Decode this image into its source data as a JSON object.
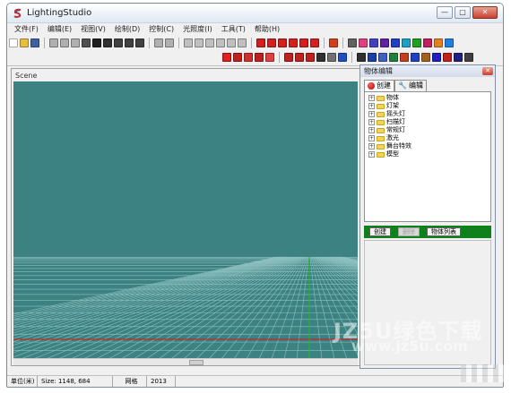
{
  "window": {
    "title": "LightingStudio",
    "minimize": "—",
    "maximize": "□",
    "close": "✕"
  },
  "menu": [
    "文件(F)",
    "编辑(E)",
    "视图(V)",
    "绘制(D)",
    "控制(C)",
    "光照度(I)",
    "工具(T)",
    "帮助(H)"
  ],
  "toolbar1": [
    {
      "icon": "new-icon",
      "color": "#ffffff"
    },
    {
      "icon": "open-icon",
      "color": "#e8c040"
    },
    {
      "icon": "save-icon",
      "color": "#4060a0"
    },
    {
      "sep": true
    },
    {
      "icon": "rotate-x-icon",
      "color": "#b0b0b0"
    },
    {
      "icon": "rotate-y-icon",
      "color": "#b0b0b0"
    },
    {
      "icon": "rotate-z-icon",
      "color": "#b0b0b0"
    },
    {
      "icon": "move-icon",
      "color": "#505050"
    },
    {
      "icon": "pointer-icon",
      "color": "#202020"
    },
    {
      "icon": "pan-icon",
      "color": "#303030"
    },
    {
      "icon": "camera-icon",
      "color": "#404040"
    },
    {
      "icon": "zoom-icon",
      "color": "#404040"
    },
    {
      "icon": "arc-icon",
      "color": "#404040"
    },
    {
      "sep": true
    },
    {
      "icon": "undo-icon",
      "color": "#b0b0b0"
    },
    {
      "icon": "redo-icon",
      "color": "#b0b0b0"
    },
    {
      "sep": true
    },
    {
      "icon": "snap-icon",
      "color": "#c0c0c0"
    },
    {
      "icon": "grid-snap-icon",
      "color": "#c0c0c0"
    },
    {
      "icon": "angle-icon",
      "color": "#c0c0c0"
    },
    {
      "icon": "curve-icon",
      "color": "#c0c0c0"
    },
    {
      "icon": "circle-icon",
      "color": "#c0c0c0"
    },
    {
      "icon": "pillar-icon",
      "color": "#c0c0c0"
    },
    {
      "sep": true
    },
    {
      "icon": "grid-view-icon",
      "color": "#d02020"
    },
    {
      "icon": "cube-front-icon",
      "color": "#d02020"
    },
    {
      "icon": "cube-side-icon",
      "color": "#d02020"
    },
    {
      "icon": "cube-top-icon",
      "color": "#d02020"
    },
    {
      "icon": "cube-persp-icon",
      "color": "#d02020"
    },
    {
      "icon": "cube-iso-icon",
      "color": "#d02020"
    },
    {
      "sep": true
    },
    {
      "icon": "cube-multi-icon",
      "color": "#d04020"
    },
    {
      "sep": true
    },
    {
      "icon": "tools-icon",
      "color": "#606060"
    },
    {
      "icon": "color-wheel-icon",
      "color": "#e04080"
    },
    {
      "icon": "pen-icon",
      "color": "#4040c0"
    },
    {
      "icon": "bars-icon",
      "color": "#6020a0"
    },
    {
      "icon": "grid-color-icon",
      "color": "#2040c0"
    },
    {
      "icon": "palette-icon",
      "color": "#20a0c0"
    },
    {
      "icon": "monitor-icon",
      "color": "#20a020"
    },
    {
      "icon": "rainbow-icon",
      "color": "#c02060"
    },
    {
      "icon": "flag-icon",
      "color": "#e08020"
    },
    {
      "icon": "color-icon",
      "color": "#2080e0"
    }
  ],
  "toolbar2": [
    {
      "icon": "sphere-icon",
      "color": "#e02020"
    },
    {
      "icon": "spot-red-icon",
      "color": "#c02020"
    },
    {
      "icon": "beam-icon",
      "color": "#d03030"
    },
    {
      "icon": "cylinder-icon",
      "color": "#c02020"
    },
    {
      "icon": "cone-icon",
      "color": "#e04040"
    },
    {
      "sep": true
    },
    {
      "icon": "box-red-icon",
      "color": "#c02020"
    },
    {
      "icon": "flag-red-icon",
      "color": "#c02020"
    },
    {
      "icon": "m-icon",
      "color": "#c02020"
    },
    {
      "icon": "square-icon",
      "color": "#303030"
    },
    {
      "icon": "doc-icon",
      "color": "#707070"
    },
    {
      "icon": "text-icon",
      "color": "#2050c0"
    },
    {
      "sep": true
    },
    {
      "icon": "line-tools-icon",
      "color": "#303030"
    },
    {
      "icon": "arrows-down-icon",
      "color": "#2040a0"
    },
    {
      "icon": "grid-blue-icon",
      "color": "#4060c0"
    },
    {
      "icon": "sphere-multi-icon",
      "color": "#208040"
    },
    {
      "icon": "color-grid-icon",
      "color": "#c04020"
    },
    {
      "icon": "bars-blue-icon",
      "color": "#2040c0"
    },
    {
      "icon": "fixture-icon",
      "color": "#a06020"
    },
    {
      "icon": "ruler-icon",
      "color": "#2020c0"
    },
    {
      "icon": "wave-icon",
      "color": "#c02020"
    },
    {
      "icon": "stage-icon",
      "color": "#202080"
    },
    {
      "icon": "lamp-icon",
      "color": "#404040"
    }
  ],
  "scene": {
    "label": "Scene",
    "background": "#3c8282",
    "grid_color": "#8ec0c0",
    "axis_x_color": "#e01010",
    "axis_y_color": "#10c010"
  },
  "prop_panel": {
    "title": "物体编辑",
    "close": "✕",
    "tab_create": "创建",
    "tab_edit": "编辑",
    "tree": [
      "物体",
      "灯架",
      "摇头灯",
      "扫描灯",
      "常规灯",
      "激光",
      "舞台特效",
      "模型"
    ],
    "btn_create": "创建",
    "btn_delete": "删除",
    "btn_list": "物体列表"
  },
  "status": {
    "unit": "单位(米)",
    "size": "Size: 1148, 684",
    "grid": "网格",
    "year": "2013"
  },
  "watermark": {
    "logo": "JZ5U绿色下载",
    "url": "www.jz5u.com"
  }
}
